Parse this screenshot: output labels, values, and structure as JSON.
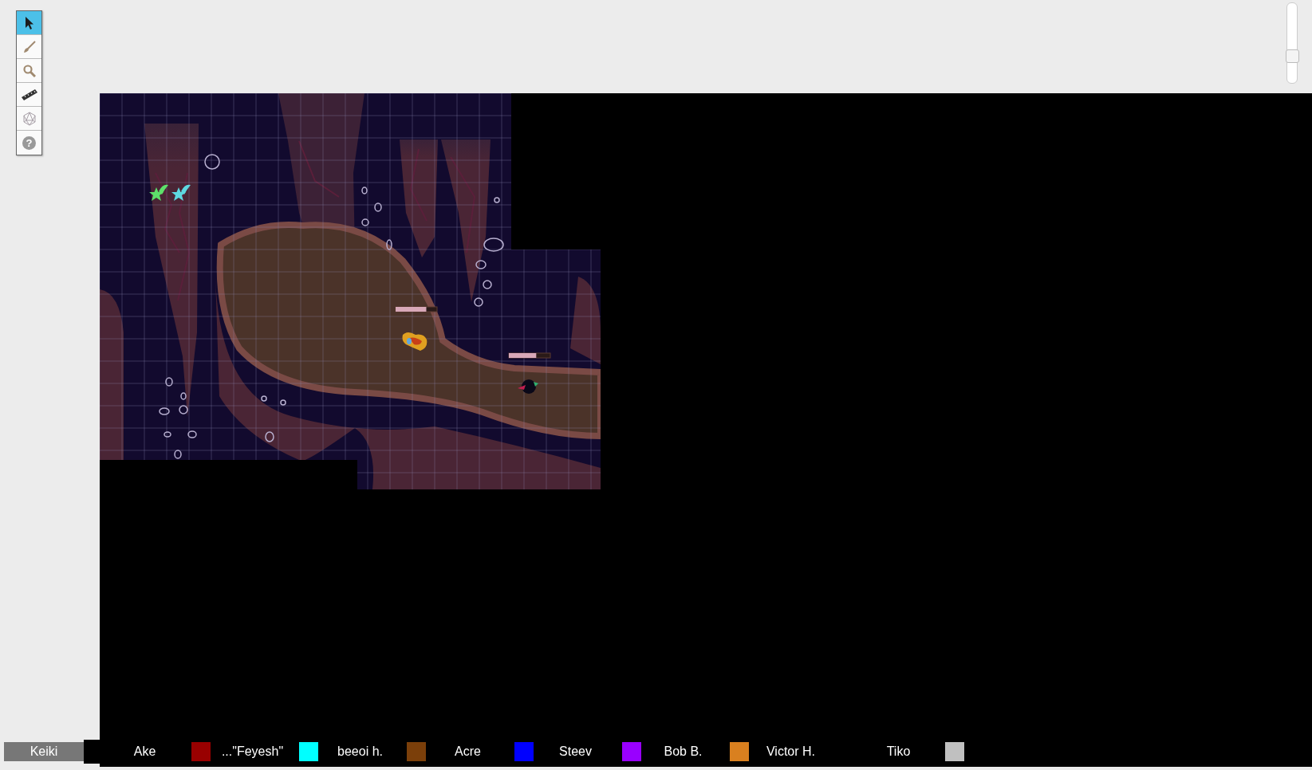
{
  "toolbar": {
    "tools": [
      {
        "kind": "pointer",
        "selected": true
      },
      {
        "kind": "brush",
        "selected": false
      },
      {
        "kind": "zoom",
        "selected": false
      },
      {
        "kind": "ruler",
        "selected": false
      },
      {
        "kind": "dice",
        "selected": false
      },
      {
        "kind": "help",
        "selected": false,
        "label": "?"
      }
    ]
  },
  "zoom_slider": {
    "level": 0.3
  },
  "map": {
    "tokens": [
      {
        "kind": "star",
        "color": "#5de06a"
      },
      {
        "kind": "star",
        "color": "#5ed8e0"
      },
      {
        "kind": "flame",
        "health": {
          "level": 0.74
        }
      },
      {
        "kind": "blob",
        "health": {
          "level": 0.66
        }
      }
    ]
  },
  "players": {
    "current": "Keiki",
    "list": [
      {
        "name": "Ake",
        "color": "#990000"
      },
      {
        "name": "...\"Feyesh\"",
        "color": "#00ffff"
      },
      {
        "name": "beeoi h.",
        "color": "#7b3f0a"
      },
      {
        "name": "Acre",
        "color": "#0000ff"
      },
      {
        "name": "Steev",
        "color": "#9900ff"
      },
      {
        "name": "Bob B.",
        "color": "#d9801f"
      },
      {
        "name": "Victor H."
      },
      {
        "name": "Tiko",
        "color": "#c0c0c0"
      }
    ]
  }
}
